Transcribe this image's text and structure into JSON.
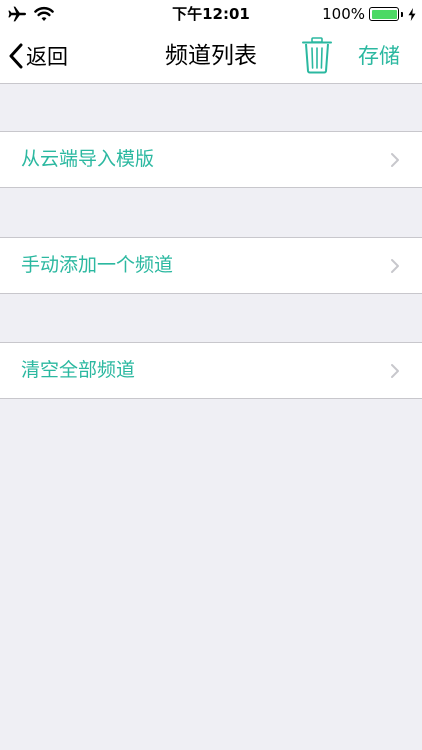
{
  "status_bar": {
    "time": "下午12:01",
    "battery_percent": "100%",
    "battery_level": 1.0,
    "icons": [
      "airplane-icon",
      "wifi-icon",
      "battery-icon",
      "charging-bolt-icon"
    ]
  },
  "nav": {
    "back_label": "返回",
    "title": "频道列表",
    "trash_icon": "trash-icon",
    "save_label": "存储"
  },
  "menu": {
    "items": [
      {
        "label": "从云端导入模版"
      },
      {
        "label": "手动添加一个频道"
      },
      {
        "label": "清空全部频道"
      }
    ]
  },
  "colors": {
    "accent": "#2bb8a0",
    "background": "#efeff4",
    "separator": "#c8c7cc",
    "battery": "#4cd964"
  }
}
